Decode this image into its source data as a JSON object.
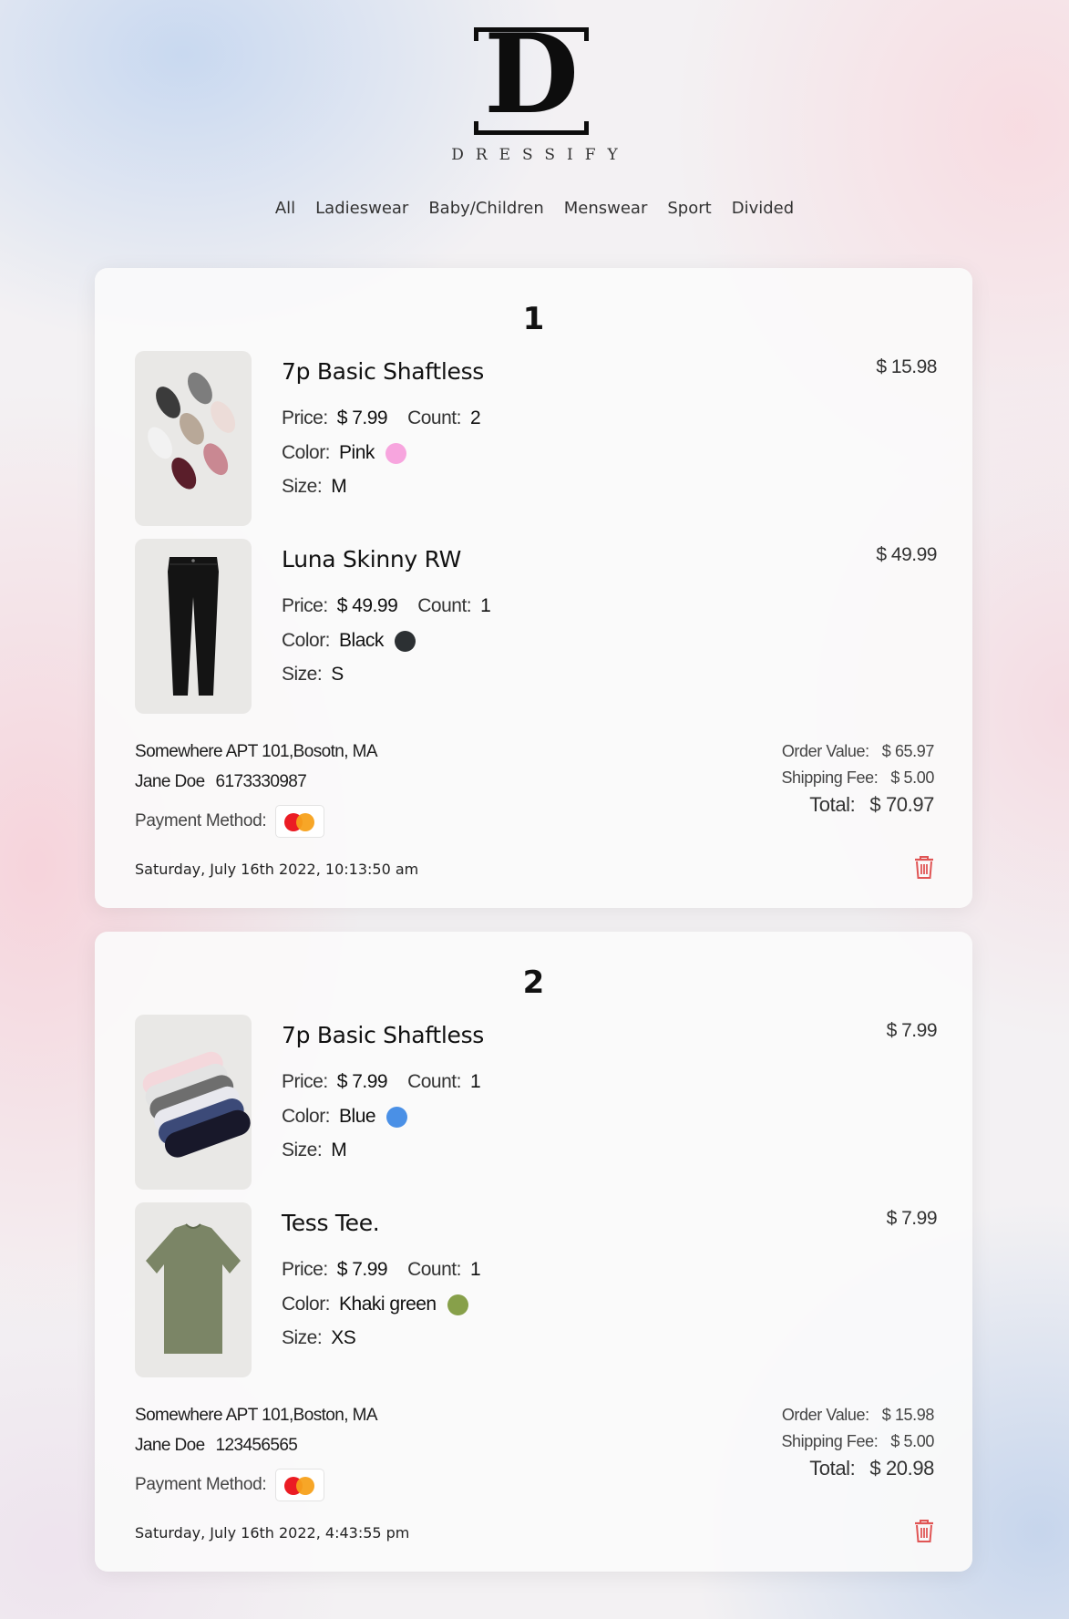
{
  "brand": {
    "monogram": "D",
    "name": "DRESSIFY"
  },
  "nav": [
    "All",
    "Ladieswear",
    "Baby/Children",
    "Menswear",
    "Sport",
    "Divided"
  ],
  "orders": [
    {
      "number": "1",
      "items": [
        {
          "name": "7p Basic Shaftless",
          "line_total": "$ 15.98",
          "price_label": "Price:",
          "price": "$ 7.99",
          "count_label": "Count:",
          "count": "2",
          "color_label": "Color:",
          "color": "Pink",
          "color_hex": "#f7a5de",
          "size_label": "Size:",
          "size": "M",
          "image_icon": "socks-colorful-image"
        },
        {
          "name": "Luna Skinny RW",
          "line_total": "$ 49.99",
          "price_label": "Price:",
          "price": "$ 49.99",
          "count_label": "Count:",
          "count": "1",
          "color_label": "Color:",
          "color": "Black",
          "color_hex": "#2c3033",
          "size_label": "Size:",
          "size": "S",
          "image_icon": "jeans-image"
        }
      ],
      "address": "Somewhere  APT 101,Bosotn, MA",
      "customer_name": "Jane Doe",
      "phone": "6173330987",
      "payment_label": "Payment Method:",
      "payment_icon": "mastercard-icon",
      "date": "Saturday, July 16th 2022, 10:13:50 am",
      "order_value_label": "Order Value:",
      "order_value": "$ 65.97",
      "shipping_label": "Shipping Fee:",
      "shipping": "$ 5.00",
      "total_label": "Total:",
      "total": "$ 70.97"
    },
    {
      "number": "2",
      "items": [
        {
          "name": "7p Basic Shaftless",
          "line_total": "$ 7.99",
          "price_label": "Price:",
          "price": "$ 7.99",
          "count_label": "Count:",
          "count": "1",
          "color_label": "Color:",
          "color": "Blue",
          "color_hex": "#4a90e6",
          "size_label": "Size:",
          "size": "M",
          "image_icon": "socks-stack-image"
        },
        {
          "name": "Tess Tee.",
          "line_total": "$ 7.99",
          "price_label": "Price:",
          "price": "$ 7.99",
          "count_label": "Count:",
          "count": "1",
          "color_label": "Color:",
          "color": "Khaki green",
          "color_hex": "#87a04a",
          "size_label": "Size:",
          "size": "XS",
          "image_icon": "tshirt-image"
        }
      ],
      "address": "Somewhere  APT 101,Boston, MA",
      "customer_name": "Jane Doe",
      "phone": "123456565",
      "payment_label": "Payment Method:",
      "payment_icon": "mastercard-icon",
      "date": "Saturday, July 16th 2022, 4:43:55 pm",
      "order_value_label": "Order Value:",
      "order_value": "$ 15.98",
      "shipping_label": "Shipping Fee:",
      "shipping": "$ 5.00",
      "total_label": "Total:",
      "total": "$ 20.98"
    }
  ],
  "colors": {
    "accent_delete": "#e05555",
    "card_bg": "#fafafa"
  }
}
